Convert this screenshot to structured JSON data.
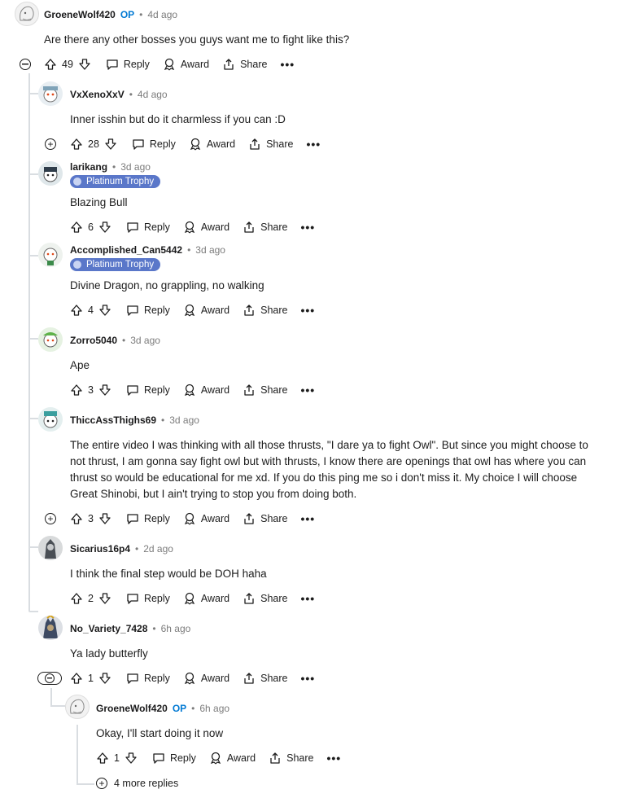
{
  "labels": {
    "reply": "Reply",
    "award": "Award",
    "share": "Share",
    "op": "OP",
    "more": "•••",
    "dot": "•",
    "platinum": "Platinum Trophy"
  },
  "comments": [
    {
      "user": "GroeneWolf420",
      "op": true,
      "age": "4d ago",
      "text": "Are there any other bosses you guys want me to fight like this?",
      "score": "49"
    },
    {
      "user": "VxXenoXxV",
      "age": "4d ago",
      "text": "Inner isshin but do it charmless if you can :D",
      "score": "28"
    },
    {
      "user": "larikang",
      "age": "3d ago",
      "badge": "Platinum Trophy",
      "text": "Blazing Bull",
      "score": "6"
    },
    {
      "user": "Accomplished_Can5442",
      "age": "3d ago",
      "badge": "Platinum Trophy",
      "text": "Divine Dragon, no grappling, no walking",
      "score": "4"
    },
    {
      "user": "Zorro5040",
      "age": "3d ago",
      "text": "Ape",
      "score": "3"
    },
    {
      "user": "ThiccAssThighs69",
      "age": "3d ago",
      "text_lines": [
        "The entire video I was thinking with all those thrusts, \"I dare ya to fight Owl\". But since you might choose to",
        "not thrust, I am gonna say fight owl but with thrusts, I know there are openings that owl has where you can",
        "thrust so would be educational for me xd. If you do this ping me so i don't miss it. My choice I will choose",
        "Great Shinobi, but I ain't trying to stop you from doing both."
      ],
      "score": "3"
    },
    {
      "user": "Sicarius16p4",
      "age": "2d ago",
      "text": "I think the final step would be DOH haha",
      "score": "2"
    },
    {
      "user": "No_Variety_7428",
      "age": "6h ago",
      "text": "Ya lady butterfly",
      "score": "1"
    },
    {
      "user": "GroeneWolf420",
      "op": true,
      "age": "6h ago",
      "text": "Okay, I'll start doing it now",
      "score": "1"
    }
  ],
  "more_replies": "4 more replies",
  "colors": {
    "op": "#0079d3",
    "badge": "#5a77c9",
    "thread_line": "#d9dde1",
    "meta": "#7c7c7c"
  }
}
